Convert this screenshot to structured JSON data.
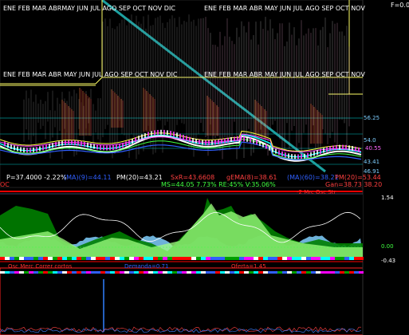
{
  "header": {
    "formula": "F=0.0",
    "months_row1": [
      "ENE",
      "FEB",
      "MAR",
      "ABR",
      "MAY",
      "JUN",
      "JUL",
      "AGO",
      "SEP",
      "OCT",
      "NOV",
      "DIC"
    ],
    "months_row2": [
      "ENE",
      "FEB",
      "MAR",
      "ABR",
      "MAY",
      "JUN",
      "JUL",
      "AGO",
      "SEP",
      "OCT",
      "NOV"
    ],
    "months_row1_top": [
      "ENE",
      "FEB",
      "MAR",
      "ABRMAY",
      "JUN",
      "JUL",
      "AGO",
      "SEP",
      "OCT",
      "NOV",
      "DIC"
    ],
    "months_row2_top": [
      "ENE",
      "FEB",
      "MAR",
      "ABR",
      "MAY",
      "JUN",
      "JUL",
      "AGO",
      "SEP",
      "OCT",
      "NOV"
    ]
  },
  "price_panel": {
    "right_labels": [
      "56.25",
      "54.0",
      "43.41",
      "40.55",
      "46.91"
    ],
    "right_label_colors": [
      "#7ecfff",
      "#7ecfff",
      "#7ecfff",
      "#ff66ff",
      "#7ecfff"
    ],
    "p_line": "P=37.4000",
    "p_change": "-2.22%",
    "ma_short": "(MA)(9)=44.11",
    "pm20": "PM(20)=43.21",
    "sxr": "SxR=43.6608",
    "gema": "gEMA(8)=38.61",
    "ma60": "(MA)(60)=38.21",
    "pm20b": "PM(20)=53.44",
    "ms_line": "MS=44.05  7.73% RE:45% V:35.06%",
    "gain_line": "Gan=38.73  38.20",
    "oc_label": "OC"
  },
  "oscillator_panel": {
    "title": "-2 Mrc Osc Str",
    "top_value": "1.54",
    "zero_value": "0.00",
    "bottom_value": "-0.43"
  },
  "volume_panel": {
    "left_label": "Osc Merc Correr cortos",
    "mid_label": "Demanda=0.71",
    "right_label": "Oferta=1.45"
  },
  "colors": {
    "accent_cyan": "#00c0c0",
    "yellow": "#ffff66",
    "red_label": "#ff3030",
    "blue_label": "#3060ff",
    "green_osc": "#00a000",
    "light_green": "#a0ff80"
  }
}
